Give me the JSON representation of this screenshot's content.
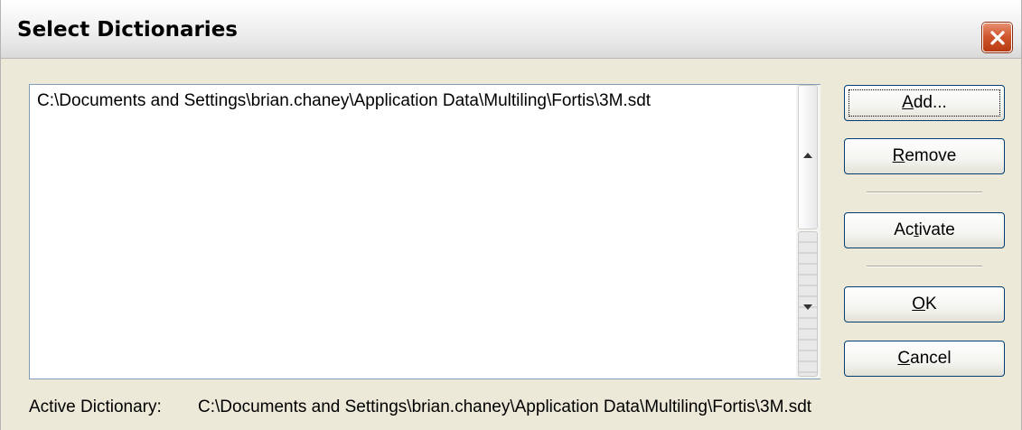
{
  "window": {
    "title": "Select Dictionaries"
  },
  "dictionaries": {
    "items": [
      "C:\\Documents and Settings\\brian.chaney\\Application Data\\Multiling\\Fortis\\3M.sdt"
    ]
  },
  "buttons": {
    "add": {
      "before": "",
      "mnemonic": "A",
      "after": "dd..."
    },
    "remove": {
      "before": "",
      "mnemonic": "R",
      "after": "emove"
    },
    "activate": {
      "before": "Ac",
      "mnemonic": "t",
      "after": "ivate"
    },
    "ok": {
      "before": "",
      "mnemonic": "O",
      "after": "K"
    },
    "cancel": {
      "before": "",
      "mnemonic": "C",
      "after": "ancel"
    }
  },
  "status": {
    "label": "Active Dictionary:",
    "value": "C:\\Documents and Settings\\brian.chaney\\Application Data\\Multiling\\Fortis\\3M.sdt"
  },
  "icons": {
    "close": "close-icon",
    "scroll_up": "scroll-up-arrow-icon",
    "scroll_down": "scroll-down-arrow-icon"
  },
  "colors": {
    "dialog_bg": "#ece9d8",
    "close_button": "#d0582f",
    "button_border": "#003c74",
    "listbox_border": "#7f9db9"
  }
}
